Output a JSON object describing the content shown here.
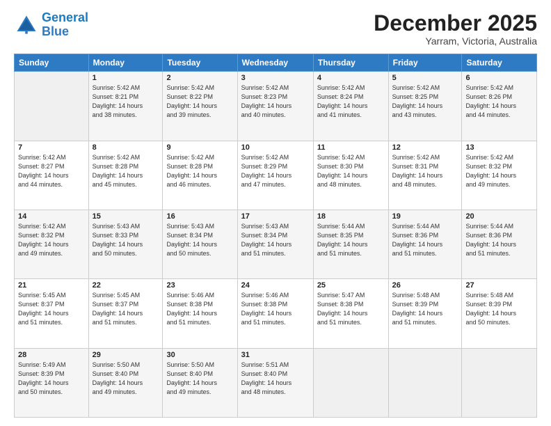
{
  "header": {
    "logo_line1": "General",
    "logo_line2": "Blue",
    "month": "December 2025",
    "location": "Yarram, Victoria, Australia"
  },
  "columns": [
    "Sunday",
    "Monday",
    "Tuesday",
    "Wednesday",
    "Thursday",
    "Friday",
    "Saturday"
  ],
  "weeks": [
    [
      {
        "day": "",
        "info": ""
      },
      {
        "day": "1",
        "info": "Sunrise: 5:42 AM\nSunset: 8:21 PM\nDaylight: 14 hours\nand 38 minutes."
      },
      {
        "day": "2",
        "info": "Sunrise: 5:42 AM\nSunset: 8:22 PM\nDaylight: 14 hours\nand 39 minutes."
      },
      {
        "day": "3",
        "info": "Sunrise: 5:42 AM\nSunset: 8:23 PM\nDaylight: 14 hours\nand 40 minutes."
      },
      {
        "day": "4",
        "info": "Sunrise: 5:42 AM\nSunset: 8:24 PM\nDaylight: 14 hours\nand 41 minutes."
      },
      {
        "day": "5",
        "info": "Sunrise: 5:42 AM\nSunset: 8:25 PM\nDaylight: 14 hours\nand 43 minutes."
      },
      {
        "day": "6",
        "info": "Sunrise: 5:42 AM\nSunset: 8:26 PM\nDaylight: 14 hours\nand 44 minutes."
      }
    ],
    [
      {
        "day": "7",
        "info": "Sunrise: 5:42 AM\nSunset: 8:27 PM\nDaylight: 14 hours\nand 44 minutes."
      },
      {
        "day": "8",
        "info": "Sunrise: 5:42 AM\nSunset: 8:28 PM\nDaylight: 14 hours\nand 45 minutes."
      },
      {
        "day": "9",
        "info": "Sunrise: 5:42 AM\nSunset: 8:28 PM\nDaylight: 14 hours\nand 46 minutes."
      },
      {
        "day": "10",
        "info": "Sunrise: 5:42 AM\nSunset: 8:29 PM\nDaylight: 14 hours\nand 47 minutes."
      },
      {
        "day": "11",
        "info": "Sunrise: 5:42 AM\nSunset: 8:30 PM\nDaylight: 14 hours\nand 48 minutes."
      },
      {
        "day": "12",
        "info": "Sunrise: 5:42 AM\nSunset: 8:31 PM\nDaylight: 14 hours\nand 48 minutes."
      },
      {
        "day": "13",
        "info": "Sunrise: 5:42 AM\nSunset: 8:32 PM\nDaylight: 14 hours\nand 49 minutes."
      }
    ],
    [
      {
        "day": "14",
        "info": "Sunrise: 5:42 AM\nSunset: 8:32 PM\nDaylight: 14 hours\nand 49 minutes."
      },
      {
        "day": "15",
        "info": "Sunrise: 5:43 AM\nSunset: 8:33 PM\nDaylight: 14 hours\nand 50 minutes."
      },
      {
        "day": "16",
        "info": "Sunrise: 5:43 AM\nSunset: 8:34 PM\nDaylight: 14 hours\nand 50 minutes."
      },
      {
        "day": "17",
        "info": "Sunrise: 5:43 AM\nSunset: 8:34 PM\nDaylight: 14 hours\nand 51 minutes."
      },
      {
        "day": "18",
        "info": "Sunrise: 5:44 AM\nSunset: 8:35 PM\nDaylight: 14 hours\nand 51 minutes."
      },
      {
        "day": "19",
        "info": "Sunrise: 5:44 AM\nSunset: 8:36 PM\nDaylight: 14 hours\nand 51 minutes."
      },
      {
        "day": "20",
        "info": "Sunrise: 5:44 AM\nSunset: 8:36 PM\nDaylight: 14 hours\nand 51 minutes."
      }
    ],
    [
      {
        "day": "21",
        "info": "Sunrise: 5:45 AM\nSunset: 8:37 PM\nDaylight: 14 hours\nand 51 minutes."
      },
      {
        "day": "22",
        "info": "Sunrise: 5:45 AM\nSunset: 8:37 PM\nDaylight: 14 hours\nand 51 minutes."
      },
      {
        "day": "23",
        "info": "Sunrise: 5:46 AM\nSunset: 8:38 PM\nDaylight: 14 hours\nand 51 minutes."
      },
      {
        "day": "24",
        "info": "Sunrise: 5:46 AM\nSunset: 8:38 PM\nDaylight: 14 hours\nand 51 minutes."
      },
      {
        "day": "25",
        "info": "Sunrise: 5:47 AM\nSunset: 8:38 PM\nDaylight: 14 hours\nand 51 minutes."
      },
      {
        "day": "26",
        "info": "Sunrise: 5:48 AM\nSunset: 8:39 PM\nDaylight: 14 hours\nand 51 minutes."
      },
      {
        "day": "27",
        "info": "Sunrise: 5:48 AM\nSunset: 8:39 PM\nDaylight: 14 hours\nand 50 minutes."
      }
    ],
    [
      {
        "day": "28",
        "info": "Sunrise: 5:49 AM\nSunset: 8:39 PM\nDaylight: 14 hours\nand 50 minutes."
      },
      {
        "day": "29",
        "info": "Sunrise: 5:50 AM\nSunset: 8:40 PM\nDaylight: 14 hours\nand 49 minutes."
      },
      {
        "day": "30",
        "info": "Sunrise: 5:50 AM\nSunset: 8:40 PM\nDaylight: 14 hours\nand 49 minutes."
      },
      {
        "day": "31",
        "info": "Sunrise: 5:51 AM\nSunset: 8:40 PM\nDaylight: 14 hours\nand 48 minutes."
      },
      {
        "day": "",
        "info": ""
      },
      {
        "day": "",
        "info": ""
      },
      {
        "day": "",
        "info": ""
      }
    ]
  ]
}
